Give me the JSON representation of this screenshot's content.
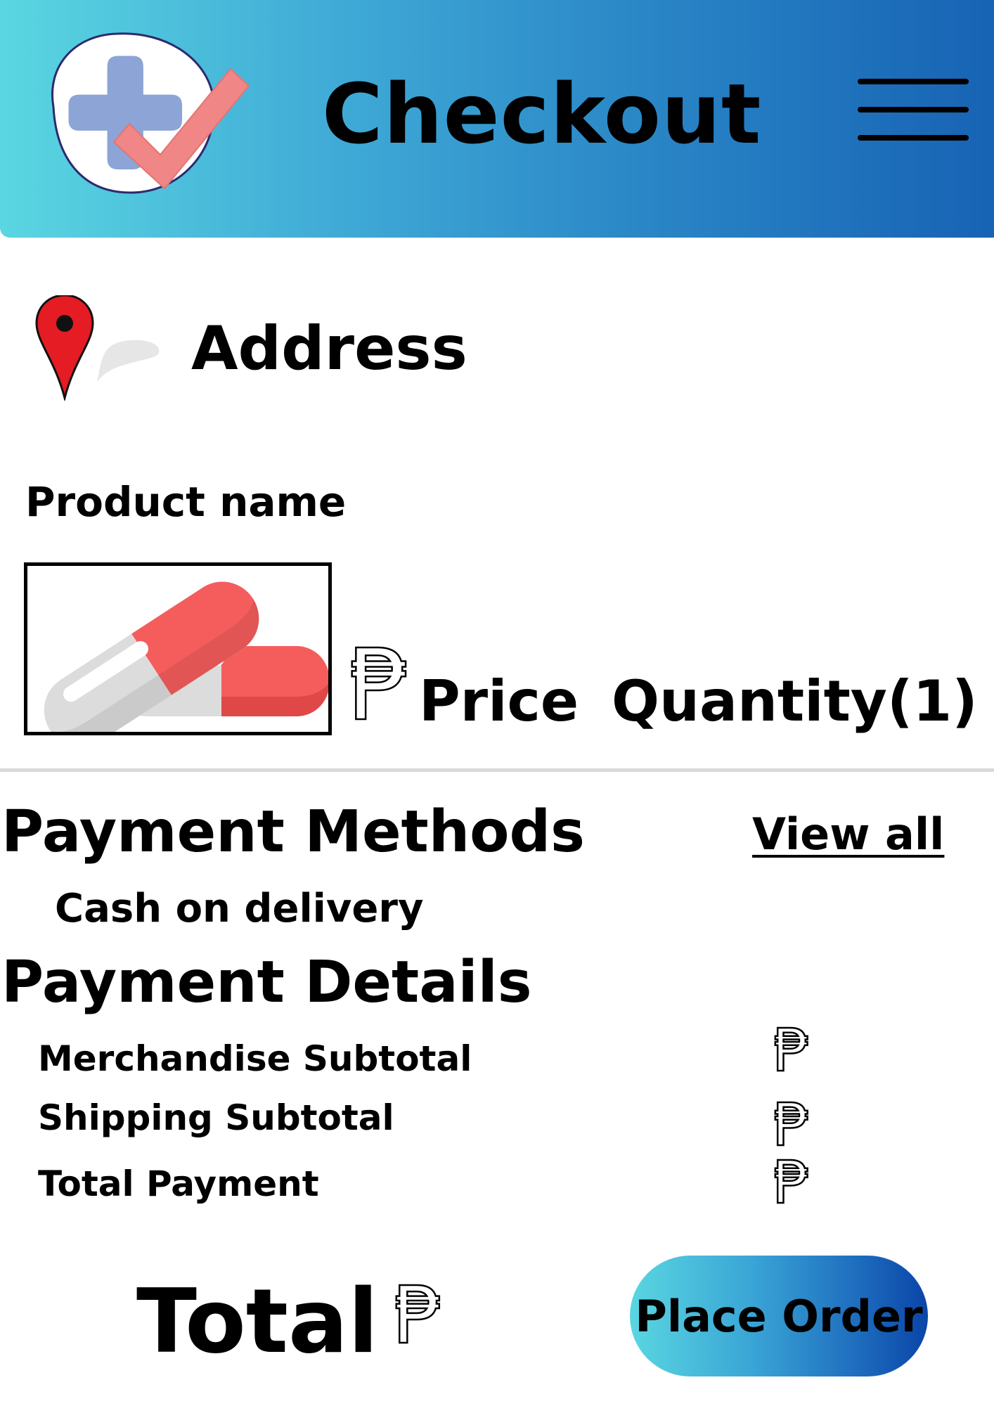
{
  "header": {
    "title": "Checkout",
    "logo_icon": "medical-cross-check-icon",
    "menu_icon": "hamburger-menu-icon",
    "gradient_start": "#5ad6e1",
    "gradient_end": "#1763b4"
  },
  "address": {
    "label": "Address",
    "icon": "map-pin-icon"
  },
  "product": {
    "name_label": "Product name",
    "image_icon": "capsule-pills-icon",
    "currency_symbol": "₱",
    "price_label": "Price",
    "quantity_label": "Quantity(1)"
  },
  "payment_methods": {
    "title": "Payment Methods",
    "view_all": "View all",
    "selected_method": "Cash on delivery"
  },
  "payment_details": {
    "title": "Payment Details",
    "rows": [
      {
        "label": "Merchandise Subtotal",
        "currency": "₱"
      },
      {
        "label": "Shipping Subtotal",
        "currency": "₱"
      },
      {
        "label": "Total Payment",
        "currency": "₱"
      }
    ]
  },
  "footer": {
    "total_label": "Total",
    "currency": "₱",
    "place_order": "Place Order",
    "button_gradient_start": "#5ad6e1",
    "button_gradient_end": "#0a45a8"
  }
}
